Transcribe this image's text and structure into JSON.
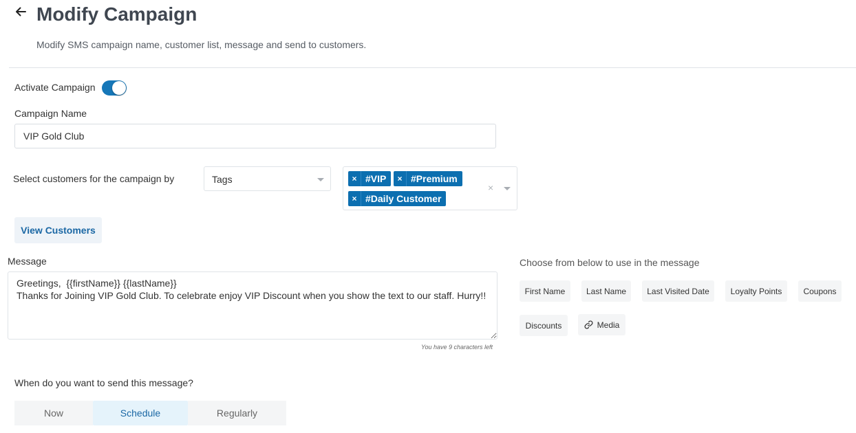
{
  "header": {
    "title": "Modify Campaign",
    "subtitle": "Modify SMS campaign name, customer list, message and send to customers."
  },
  "activate": {
    "label": "Activate Campaign",
    "enabled": true
  },
  "campaign_name": {
    "label": "Campaign Name",
    "value": "VIP Gold Club"
  },
  "customers": {
    "label": "Select customers for the campaign by",
    "filter_type": "Tags",
    "tags": [
      "#VIP",
      "#Premium",
      "#Daily Customer"
    ],
    "view_button": "View Customers"
  },
  "message": {
    "label": "Message",
    "value": "Greetings,  {{firstName}} {{lastName}}\nThanks for Joining VIP Gold Club. To celebrate enjoy VIP Discount when you show the text to our staff. Hurry!!",
    "chars_left": "You have 9 characters left"
  },
  "placeholders": {
    "label": "Choose from below to use in the message",
    "items": [
      "First Name",
      "Last Name",
      "Last Visited Date",
      "Loyalty Points",
      "Coupons",
      "Discounts",
      "Media"
    ]
  },
  "send": {
    "label": "When do you want to send this message?",
    "options": [
      "Now",
      "Schedule",
      "Regularly"
    ],
    "selected": "Schedule"
  },
  "colors": {
    "primary": "#1677b8",
    "tag": "#0c6fb0",
    "selected_bg": "#e5f3fb"
  }
}
